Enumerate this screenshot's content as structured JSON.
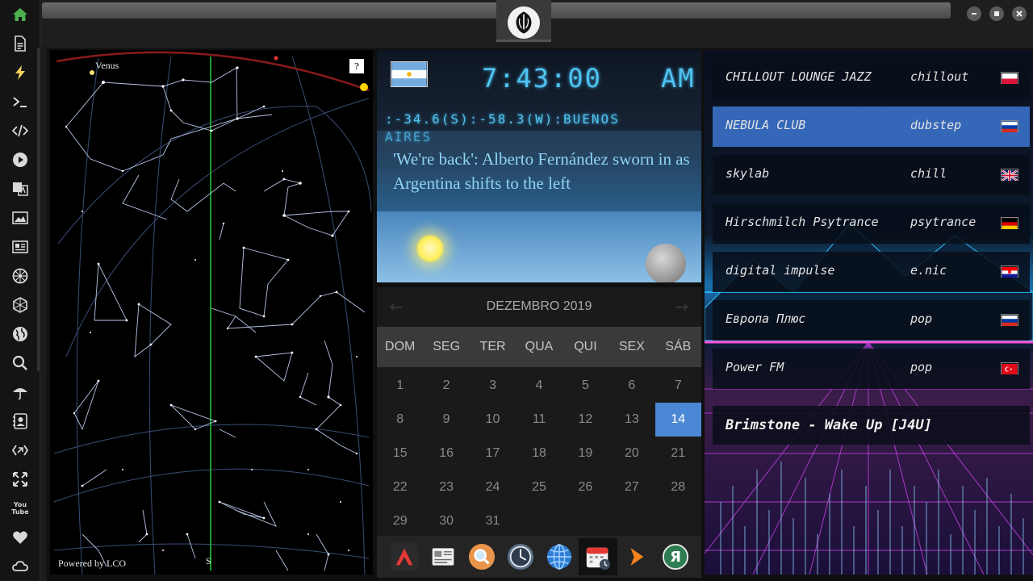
{
  "sidebar": {
    "items": [
      {
        "icon": "home-icon"
      },
      {
        "icon": "document-icon"
      },
      {
        "icon": "lightning-icon"
      },
      {
        "icon": "terminal-icon"
      },
      {
        "icon": "code-icon"
      },
      {
        "icon": "play-icon"
      },
      {
        "icon": "translate-icon"
      },
      {
        "icon": "image-icon"
      },
      {
        "icon": "news-icon"
      },
      {
        "icon": "settings-wheel-icon"
      },
      {
        "icon": "hexagon-icon"
      },
      {
        "icon": "globe-icon"
      },
      {
        "icon": "search-icon"
      },
      {
        "icon": "umbrella-icon"
      },
      {
        "icon": "contact-icon"
      },
      {
        "icon": "transfer-icon"
      },
      {
        "icon": "expand-icon"
      },
      {
        "icon": "youtube-icon"
      },
      {
        "icon": "heart-icon"
      },
      {
        "icon": "cloud-icon"
      }
    ],
    "youtube_text": "You Tube"
  },
  "starmap": {
    "planet_label": "Venus",
    "help_label": "?",
    "credit": "Powered by LCO",
    "direction": "S"
  },
  "clock": {
    "time": "7:43:00",
    "ampm": "AM",
    "location_line1": ":-34.6(S):-58.3(W):BUENOS",
    "location_line2": "AIRES",
    "headline": "'We're back': Alberto Fernández sworn in as Argentina shifts to the left"
  },
  "calendar": {
    "month_label": "DEZEMBRO 2019",
    "weekdays": [
      "DOM",
      "SEG",
      "TER",
      "QUA",
      "QUI",
      "SEX",
      "SÁB"
    ],
    "days": [
      "1",
      "2",
      "3",
      "4",
      "5",
      "6",
      "7",
      "8",
      "9",
      "10",
      "11",
      "12",
      "13",
      "14",
      "15",
      "16",
      "17",
      "18",
      "19",
      "20",
      "21",
      "22",
      "23",
      "24",
      "25",
      "26",
      "27",
      "28",
      "29",
      "30",
      "31"
    ],
    "selected_day": "14"
  },
  "dock": {
    "items": [
      "app-icon-red",
      "news-app-icon",
      "search-app-icon",
      "clock-app-icon",
      "globe-app-icon",
      "calendar-app-icon",
      "play-app-icon",
      "yandex-app-icon"
    ],
    "yandex_letter": "Я"
  },
  "radio": {
    "stations": [
      {
        "name": "CHILLOUT LOUNGE JAZZ",
        "genre": "chillout",
        "flag": "poland"
      },
      {
        "name": "NEBULA CLUB",
        "genre": "dubstep",
        "flag": "russia"
      },
      {
        "name": "skylab",
        "genre": "chill",
        "flag": "uk"
      },
      {
        "name": "Hirschmilch Psytrance",
        "genre": "psytrance",
        "flag": "germany"
      },
      {
        "name": "digital impulse",
        "genre": "e.nic",
        "flag": "croatia"
      },
      {
        "name": "Европа Плюс",
        "genre": "pop",
        "flag": "russia"
      },
      {
        "name": "Power FM",
        "genre": "pop",
        "flag": "turkey"
      }
    ],
    "selected_station": "NEBULA CLUB",
    "now_playing": "Brimstone - Wake Up [J4U]"
  },
  "colors": {
    "accent": "#4a87d4",
    "radio_selected": "#3567b8",
    "digital": "#4fc3f0",
    "home_icon": "#4caf50",
    "lightning_icon": "#f4d35e"
  }
}
